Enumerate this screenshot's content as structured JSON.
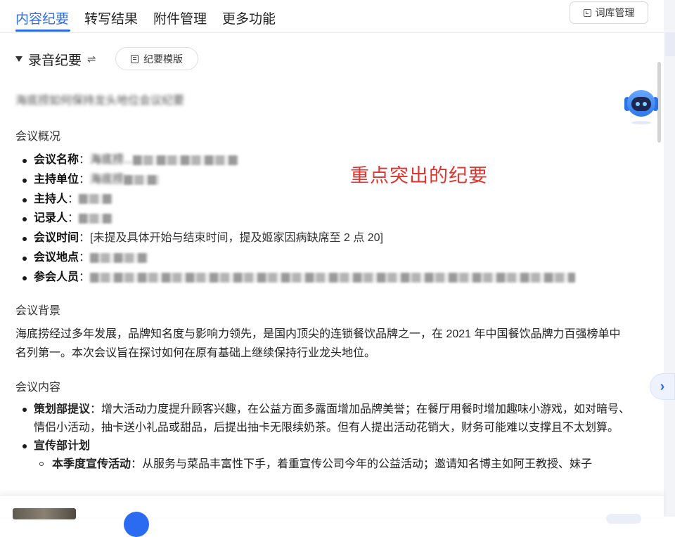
{
  "tabs": [
    {
      "label": "内容纪要",
      "active": true
    },
    {
      "label": "转写结果",
      "active": false
    },
    {
      "label": "附件管理",
      "active": false
    },
    {
      "label": "更多功能",
      "active": false
    }
  ],
  "vocab_button": "词库管理",
  "section_toggle": {
    "title": "录音纪要",
    "swap_glyph": "⇌"
  },
  "template_button": "纪要模版",
  "doc_title": "海底捞如何保持龙头地位会议纪要",
  "overview": {
    "heading": "会议概况",
    "items": [
      {
        "label": "会议名称",
        "sep": "：",
        "value": "海底捞..."
      },
      {
        "label": "主持单位",
        "sep": "：",
        "value": "海底捞"
      },
      {
        "label": "主持人",
        "sep": "：",
        "value": ""
      },
      {
        "label": "记录人",
        "sep": "：",
        "value": ""
      },
      {
        "label": "会议时间",
        "sep": "：",
        "value": "[未提及具体开始与结束时间，提及姬家因病缺席至 2 点 20]"
      },
      {
        "label": "会议地点",
        "sep": "：",
        "value": ""
      },
      {
        "label": "参会人员",
        "sep": "：",
        "value": ""
      }
    ]
  },
  "annotation": "重点突出的纪要",
  "background": {
    "heading": "会议背景",
    "text": "海底捞经过多年发展，品牌知名度与影响力领先，是国内顶尖的连锁餐饮品牌之一，在 2021 年中国餐饮品牌力百强榜单中名列第一。本次会议旨在探讨如何在原有基础上继续保持行业龙头地位。"
  },
  "content": {
    "heading": "会议内容",
    "items": [
      {
        "label": "策划部提议",
        "sep": "：",
        "text": "增大活动力度提升顾客兴趣，在公益方面多露面增加品牌美誉；在餐厅用餐时增加趣味小游戏，如对暗号、情侣小活动，抽卡送小礼品或甜品，后提出抽卡无限续奶茶。但有人提出活动花销大，财务可能难以支撑且不太划算。"
      },
      {
        "label": "宣传部计划",
        "sub": [
          {
            "label": "本季度宣传活动",
            "sep": "：",
            "text": "从服务与菜品丰富性下手，着重宣传公司今年的公益活动；邀请知名博主如阿王教授、妹子"
          }
        ]
      }
    ]
  },
  "icons": {
    "vocab": "vocab-box-icon",
    "template": "template-doc-icon",
    "robot": "robot-assistant-icon",
    "next": "chevron-right-icon",
    "next_glyph": "›"
  },
  "colors": {
    "accent": "#2a6bf2",
    "annotation": "#e0342f"
  }
}
